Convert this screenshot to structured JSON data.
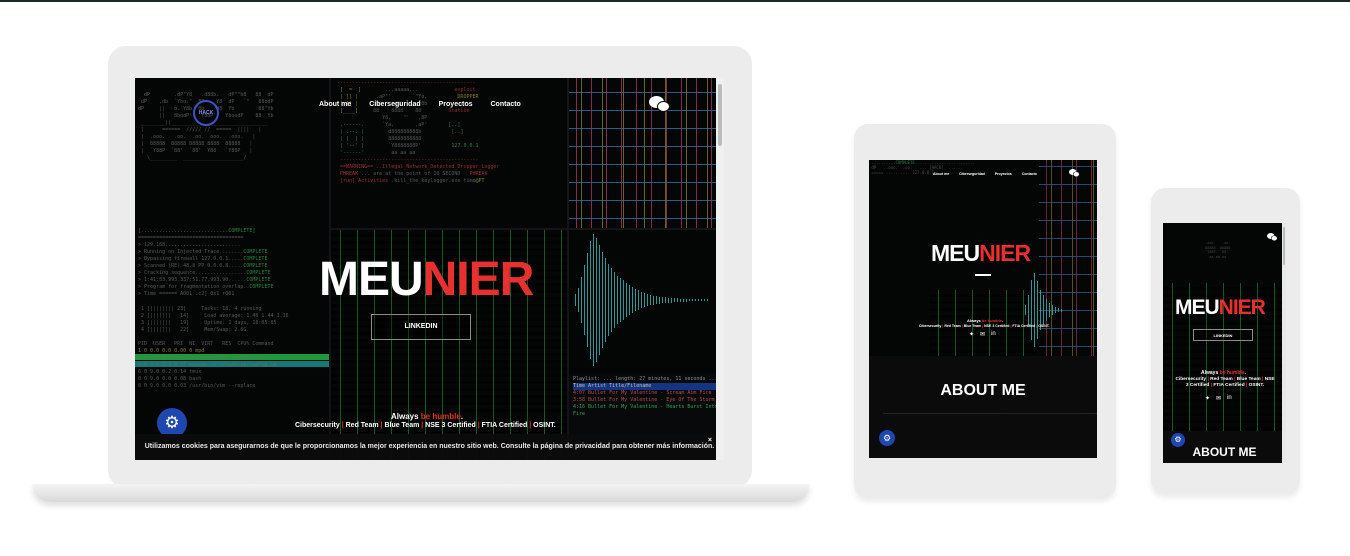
{
  "site": {
    "brand_white": "MEU",
    "brand_red": "NIER",
    "nav": [
      "About me",
      "Ciberseguridad",
      "Proyectos",
      "Contacto"
    ],
    "hack_logo_text": "HACK",
    "linkedin_label": "LINKEDIN",
    "tagline_prefix": "Always ",
    "tagline_highlight": "be humble",
    "tagline_suffix": ".",
    "certs": [
      "Cibersecurity",
      "Red Team",
      "Blue Team",
      "NSE 3 Certified",
      "FTIA Certified",
      "OSINT."
    ],
    "cookie_text": "Utilizamos cookies para asegurarnos de que le proporcionamos la mejor experiencia en nuestro sitio web. Consulte la página de privacidad para obtener más información.",
    "cookie_close": "×",
    "about_title": "ABOUT ME",
    "settings_icon": "⚙"
  },
  "colors": {
    "accent_red": "#e8302f",
    "settings_blue": "#1e47b0",
    "terminal_green": "#3ee06b"
  },
  "icons": [
    "wechat-icon",
    "twitter-icon",
    "mail-icon",
    "linkedin-icon",
    "gear-icon",
    "close-icon"
  ]
}
